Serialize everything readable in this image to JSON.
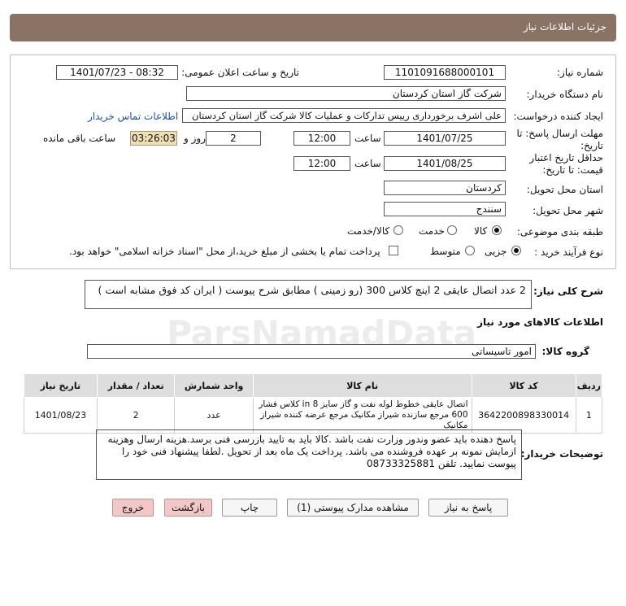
{
  "header": {
    "title": "جزئیات اطلاعات نیاز"
  },
  "labels": {
    "need_number": "شماره نیاز:",
    "announce_datetime": "تاریخ و ساعت اعلان عمومی:",
    "buyer_org": "نام دستگاه خریدار:",
    "requester": "ایجاد کننده درخواست:",
    "contact_link": "اطلاعات تماس خریدار",
    "reply_deadline": "مهلت ارسال پاسخ: تا تاریخ:",
    "time": "ساعت",
    "days_and": "روز و",
    "remaining": "ساعت باقی مانده",
    "price_validity": "حداقل تاریخ اعتبار قیمت: تا تاریخ:",
    "province": "استان محل تحویل:",
    "city": "شهر محل تحویل:",
    "category": "طبقه بندی موضوعی:",
    "process_type": "نوع فرآیند خرید :",
    "general_desc": "شرح کلی نیاز:",
    "goods_info": "اطلاعات کالاهای مورد نیاز",
    "goods_group": "گروه کالا:",
    "buyer_notes": "توضیحات خریدار:"
  },
  "fields": {
    "need_number": "1101091688000101",
    "announce_datetime": "1401/07/23 - 08:32",
    "buyer_org": "شرکت گاز استان کردستان",
    "requester": "علی اشرف برخورداری رییس تدارکات و عملیات کالا شرکت گاز استان کردستان",
    "reply_date": "1401/07/25",
    "reply_time": "12:00",
    "days": "2",
    "remaining": "03:26:03",
    "validity_date": "1401/08/25",
    "validity_time": "12:00",
    "province": "کردستان",
    "city": "سنندج",
    "general_desc": "2 عدد اتصال عایقی 2 اینچ کلاس 300 (رو زمینی ) مطابق شرح پیوست ( ایران کد فوق مشابه است )",
    "goods_group": "امور تاسیساتی",
    "buyer_notes": "پاسخ دهنده باید عضو وندور وزارت نفت باشد .کالا باید به تایید بازرسی فنی  برسد.هزینه ارسال وهزینه ازمایش نمونه بر عهده فروشنده می باشد. پرداخت یک ماه بعد از تحویل .لطفا پیشنهاد فنی خود را پیوست نمایید. تلفن 08733325881"
  },
  "category_options": {
    "goods": "کالا",
    "service": "خدمت",
    "goods_service": "کالا/خدمت",
    "selected": "کالا"
  },
  "process_options": {
    "partial": "جزیی",
    "medium": "متوسط",
    "treasury_note": "پرداخت تمام یا بخشی از مبلغ خرید،از محل \"اسناد خزانه اسلامی\" خواهد بود.",
    "selected": "جزیی"
  },
  "table": {
    "headers": [
      "ردیف",
      "کد کالا",
      "نام کالا",
      "واحد شمارش",
      "تعداد / مقدار",
      "تاریخ نیاز"
    ],
    "rows": [
      {
        "row": "1",
        "code": "3642200898330014",
        "name": "اتصال عایقی خطوط لوله نفت و گاز سایز 8 in کلاس فشار 600 مرجع سازنده شیراز مکانیک مرجع عرضه کننده شیراز مکانیک",
        "unit": "عدد",
        "qty": "2",
        "date": "1401/08/23"
      }
    ]
  },
  "buttons": {
    "reply": "پاسخ به نیاز",
    "view_docs": "مشاهده مدارک پیوستی (1)",
    "print": "چاپ",
    "back": "بازگشت",
    "exit": "خروج"
  }
}
